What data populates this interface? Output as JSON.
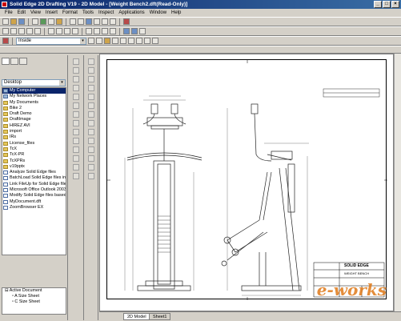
{
  "window": {
    "title": "Solid Edge 2D Drafting V19 - 2D Model - [Weight Bench2.dft(Read-Only)]",
    "buttons": [
      "_",
      "□",
      "×"
    ]
  },
  "menu": [
    "File",
    "Edit",
    "View",
    "Insert",
    "Format",
    "Tools",
    "Inspect",
    "Applications",
    "Window",
    "Help"
  ],
  "toolbar": {
    "font_combo": "Inside"
  },
  "library": {
    "location": "Desktop",
    "items": [
      {
        "label": "My Computer",
        "icon": "computer-icon",
        "selected": true
      },
      {
        "label": "My Network Places",
        "icon": "network-icon"
      },
      {
        "label": "My Documents",
        "icon": "folder-icon"
      },
      {
        "label": "Bike 2",
        "icon": "folder-icon"
      },
      {
        "label": "Draft Demo",
        "icon": "folder-icon"
      },
      {
        "label": "DraftImage",
        "icon": "folder-icon"
      },
      {
        "label": "HIREZ AVI",
        "icon": "folder-icon"
      },
      {
        "label": "import",
        "icon": "folder-icon"
      },
      {
        "label": "IRs",
        "icon": "folder-icon"
      },
      {
        "label": "License_files",
        "icon": "folder-icon"
      },
      {
        "label": "TcX",
        "icon": "folder-icon"
      },
      {
        "label": "TcX-PR",
        "icon": "folder-icon"
      },
      {
        "label": "TcXPRs",
        "icon": "folder-icon"
      },
      {
        "label": "v19pptx",
        "icon": "folder-icon"
      },
      {
        "label": "Analyze Solid Edge files",
        "icon": "shortcut-icon"
      },
      {
        "label": "BatchLoad Solid Edge files into",
        "icon": "shortcut-icon"
      },
      {
        "label": "Link FileUp for Solid Edge files",
        "icon": "shortcut-icon"
      },
      {
        "label": "Microsoft Office Outlook 2003",
        "icon": "shortcut-icon"
      },
      {
        "label": "Modify Solid Edge files based",
        "icon": "shortcut-icon"
      },
      {
        "label": "MyDocument.dft",
        "icon": "document-icon"
      },
      {
        "label": "ZoomBrowser EX",
        "icon": "shortcut-icon"
      }
    ]
  },
  "active_document": {
    "root": "Active Document",
    "sheets": [
      "A Size Sheet",
      "C Size Sheet"
    ]
  },
  "sheet_tabs": [
    "2D Model",
    "Sheet1"
  ],
  "title_block": {
    "company": "SOLID EDGE",
    "subtitle": "WEIGHT BENCH"
  },
  "watermark": "e-works"
}
